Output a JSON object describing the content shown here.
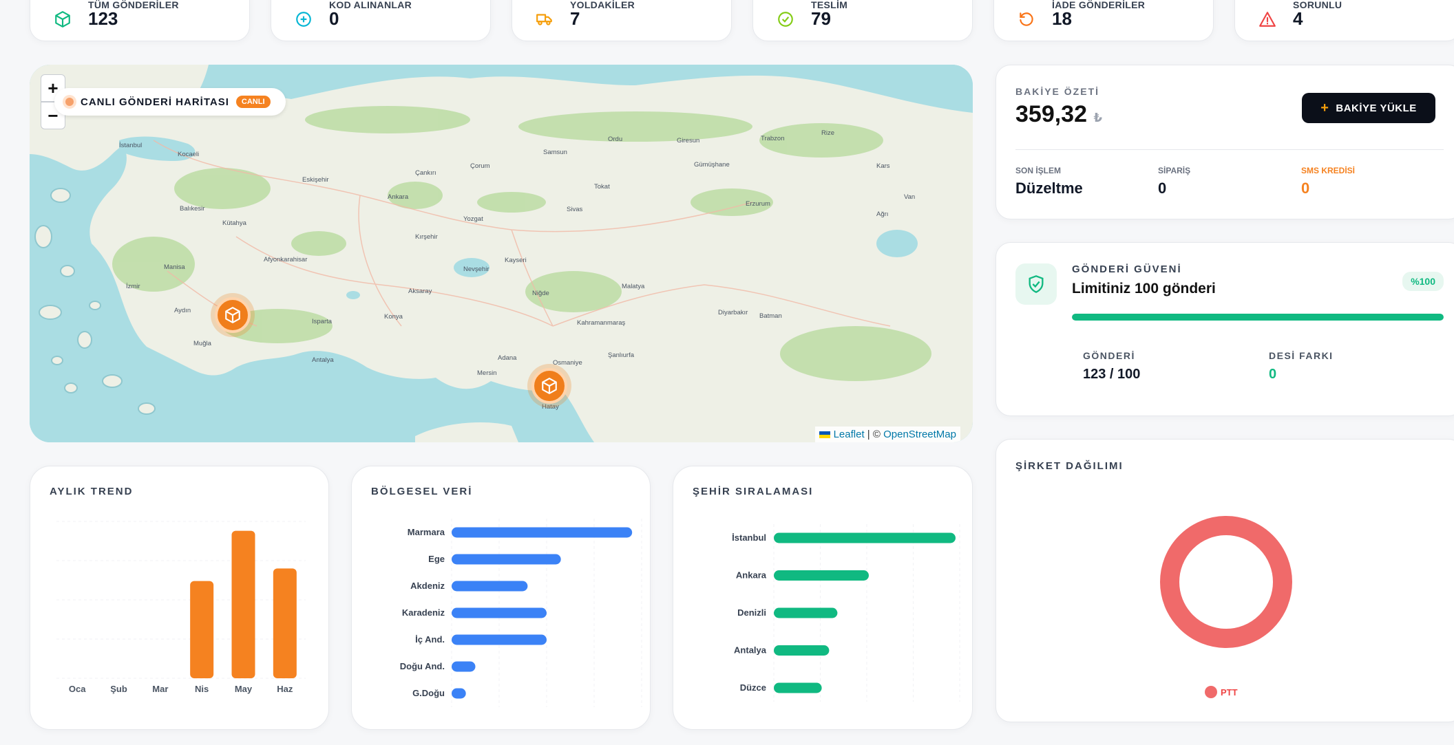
{
  "stats": [
    {
      "label": "TÜM GÖNDERİLER",
      "value": "123",
      "icon": "cube-icon",
      "color": "#10b981"
    },
    {
      "label": "KOD ALINANLAR",
      "value": "0",
      "icon": "plus-circle-icon",
      "color": "#06b6d4"
    },
    {
      "label": "YOLDAKİLER",
      "value": "7",
      "icon": "truck-icon",
      "color": "#f59e0b"
    },
    {
      "label": "TESLİM",
      "value": "79",
      "icon": "check-circle-icon",
      "color": "#84cc16"
    },
    {
      "label": "İADE GÖNDERİLER",
      "value": "18",
      "icon": "refresh-icon",
      "color": "#f97316"
    },
    {
      "label": "SORUNLU",
      "value": "4",
      "icon": "warning-icon",
      "color": "#ef4444"
    }
  ],
  "map": {
    "title": "CANLI GÖNDERİ HARİTASI",
    "badge": "CANLI",
    "zoom_in": "+",
    "zoom_out": "−",
    "attribution_leaflet": "Leaflet",
    "attribution_sep": " | © ",
    "attribution_osm": "OpenStreetMap",
    "cities": [
      "İstanbul",
      "Kocaeli",
      "Balıkesir",
      "Eskişehir",
      "Ankara",
      "Çorum",
      "Samsun",
      "Ordu",
      "Giresun",
      "Gümüşhane",
      "Trabzon",
      "Rize",
      "Erzurum",
      "Sivas",
      "Kayseri",
      "Malatya",
      "Diyarbakır",
      "Batman",
      "Kahramanmaraş",
      "Adana",
      "Mersin",
      "Osmaniye",
      "Hatay",
      "Şanlıurfa",
      "Konya",
      "Isparta",
      "Antalya",
      "Aydın",
      "Muğla",
      "İzmir",
      "Manisa",
      "Kütahya",
      "Afyonkarahisar",
      "Aksaray",
      "Yozgat",
      "Kırşehir",
      "Nevşehir",
      "Niğde",
      "Van",
      "Ağrı",
      "Kars",
      "Çankırı",
      "Tokat"
    ]
  },
  "balance": {
    "label": "BAKİYE ÖZETİ",
    "amount": "359,32",
    "currency": "₺",
    "button": "BAKİYE YÜKLE",
    "items": [
      {
        "label": "SON İŞLEM",
        "value": "Düzeltme"
      },
      {
        "label": "SİPARİŞ",
        "value": "0"
      },
      {
        "label": "SMS KREDİSİ",
        "value": "0"
      }
    ]
  },
  "trust": {
    "title": "GÖNDERİ GÜVENİ",
    "subtitle": "Limitiniz 100 gönderi",
    "percent_badge": "%100",
    "progress": 1.0,
    "left_label": "GÖNDERİ",
    "left_value": "123 / 100",
    "right_label": "DESİ FARKI",
    "right_value": "0"
  },
  "colors": {
    "accent_orange": "#f58220",
    "blue": "#3b82f6",
    "green": "#10b981",
    "red": "#f06a6a",
    "dark": "#0f172a"
  },
  "charts": {
    "monthly": {
      "title": "AYLIK TREND"
    },
    "regional": {
      "title": "BÖLGESEL VERİ"
    },
    "cities": {
      "title": "ŞEHİR SIRALAMASI"
    },
    "company": {
      "title": "ŞİRKET DAĞILIMI"
    }
  },
  "chart_data": [
    {
      "type": "bar",
      "title": "AYLIK TREND",
      "categories": [
        "Oca",
        "Şub",
        "Mar",
        "Nis",
        "May",
        "Haz"
      ],
      "values": [
        0,
        0,
        0,
        31,
        47,
        35
      ],
      "color": "#f58220"
    },
    {
      "type": "bar",
      "orientation": "horizontal",
      "title": "BÖLGESEL VERİ",
      "categories": [
        "Marmara",
        "Ege",
        "Akdeniz",
        "Karadeniz",
        "İç And.",
        "Doğu And.",
        "G.Doğu"
      ],
      "values": [
        38,
        23,
        16,
        20,
        20,
        5,
        3
      ],
      "color": "#3b82f6"
    },
    {
      "type": "bar",
      "orientation": "horizontal",
      "title": "ŞEHİR SIRALAMASI",
      "categories": [
        "İstanbul",
        "Ankara",
        "Denizli",
        "Antalya",
        "Düzce"
      ],
      "values": [
        22,
        11.5,
        7.7,
        6.7,
        5.8
      ],
      "color": "#10b981"
    },
    {
      "type": "pie",
      "title": "ŞİRKET DAĞILIMI",
      "categories": [
        "PTT"
      ],
      "values": [
        100
      ],
      "color": "#f06a6a"
    }
  ]
}
